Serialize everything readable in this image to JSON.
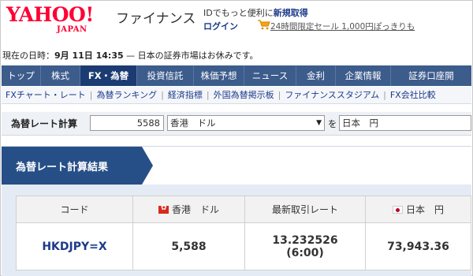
{
  "header": {
    "logo_text": "YAHOO!",
    "logo_sub": "JAPAN",
    "brand": "ファイナンス",
    "login_prefix": "IDでもっと便利に",
    "login_signup": "新規取得",
    "login": "ログイン",
    "sale": "24時間限定セール 1,000円ぽっきりも"
  },
  "status": {
    "prefix": "現在の日時：",
    "datetime": "9月 11日 14:35",
    "message": " — 日本の証券市場はお休みです。"
  },
  "nav": {
    "items": [
      "トップ",
      "株式",
      "FX・為替",
      "投資信託",
      "株価予想",
      "ニュース",
      "金利",
      "企業情報",
      "証券口座開"
    ],
    "active_index": 2
  },
  "subnav": {
    "items": [
      "FXチャート・レート",
      "為替ランキング",
      "経済指標",
      "外国為替掲示板",
      "ファイナンススタジアム",
      "FX会社比較"
    ]
  },
  "calc": {
    "label": "為替レート計算",
    "amount": "5588",
    "from_currency": "香港　ドル",
    "to_label": "を",
    "to_currency": "日本　円"
  },
  "result": {
    "title": "為替レート計算結果",
    "headers": {
      "code": "コード",
      "from": "香港　ドル",
      "rate": "最新取引レート",
      "to": "日本　円"
    },
    "row": {
      "code": "HKDJPY=X",
      "from_amount": "5,588",
      "rate": "13.232526",
      "rate_time": "(6:00)",
      "to_amount": "73,943.36"
    }
  },
  "colors": {
    "logo_red": "#ff0033",
    "nav_bg": "#3c5c8c",
    "nav_active": "#1b3b72",
    "link_blue": "#1d3a8a",
    "panel_title_bg": "#274f87"
  }
}
